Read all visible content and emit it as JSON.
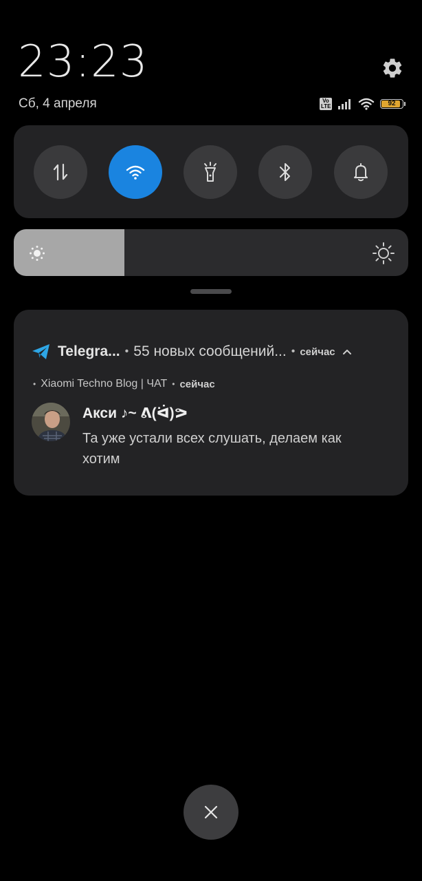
{
  "status": {
    "time": "23:23",
    "date": "Сб, 4 апреля",
    "volte_label": "Vo LTE",
    "battery_level": 92,
    "battery_color": "#e0a630"
  },
  "quick_toggles": [
    {
      "name": "mobile-data",
      "icon": "data-arrows-icon",
      "active": false
    },
    {
      "name": "wifi",
      "icon": "wifi-icon",
      "active": true
    },
    {
      "name": "flashlight",
      "icon": "flashlight-icon",
      "active": false
    },
    {
      "name": "bluetooth",
      "icon": "bluetooth-icon",
      "active": false
    },
    {
      "name": "sound",
      "icon": "bell-icon",
      "active": false
    }
  ],
  "brightness": {
    "level_fraction": 0.28
  },
  "notification": {
    "app_name": "Telegra...",
    "summary": "55 новых сообщений...",
    "time": "сейчас",
    "chat_name": "Xiaomi Techno Blog | ЧАТ",
    "chat_time": "сейчас",
    "sender": "Акси ♪~ ᕕ(ᐛ)ᕗ",
    "message": "Та уже устали всех слушать, делаем как хотим"
  },
  "colors": {
    "accent": "#1a84e0",
    "telegram": "#2ea6e5",
    "panel": "#232325"
  }
}
